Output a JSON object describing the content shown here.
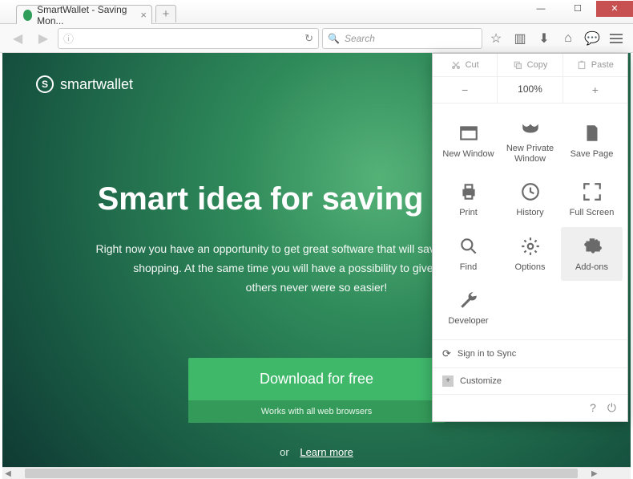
{
  "window": {
    "tab_title": "SmartWallet - Saving Mon..."
  },
  "nav": {
    "search_placeholder": "Search"
  },
  "page": {
    "brand": "smartwallet",
    "headline": "Smart idea for saving money",
    "sub1": "Right now you have an opportunity to get great software that will save your money during",
    "sub2": "shopping. At the same time you will have a possibility to give advice to the",
    "sub3": "others never were so easier!",
    "download": "Download for free",
    "works": "Works with all web browsers",
    "or": "or",
    "learn": "Learn more"
  },
  "menu": {
    "cut": "Cut",
    "copy": "Copy",
    "paste": "Paste",
    "zoom": "100%",
    "items": {
      "new_window": "New Window",
      "new_private": "New Private Window",
      "save_page": "Save Page",
      "print": "Print",
      "history": "History",
      "full_screen": "Full Screen",
      "find": "Find",
      "options": "Options",
      "addons": "Add-ons",
      "developer": "Developer"
    },
    "signin": "Sign in to Sync",
    "customize": "Customize"
  }
}
